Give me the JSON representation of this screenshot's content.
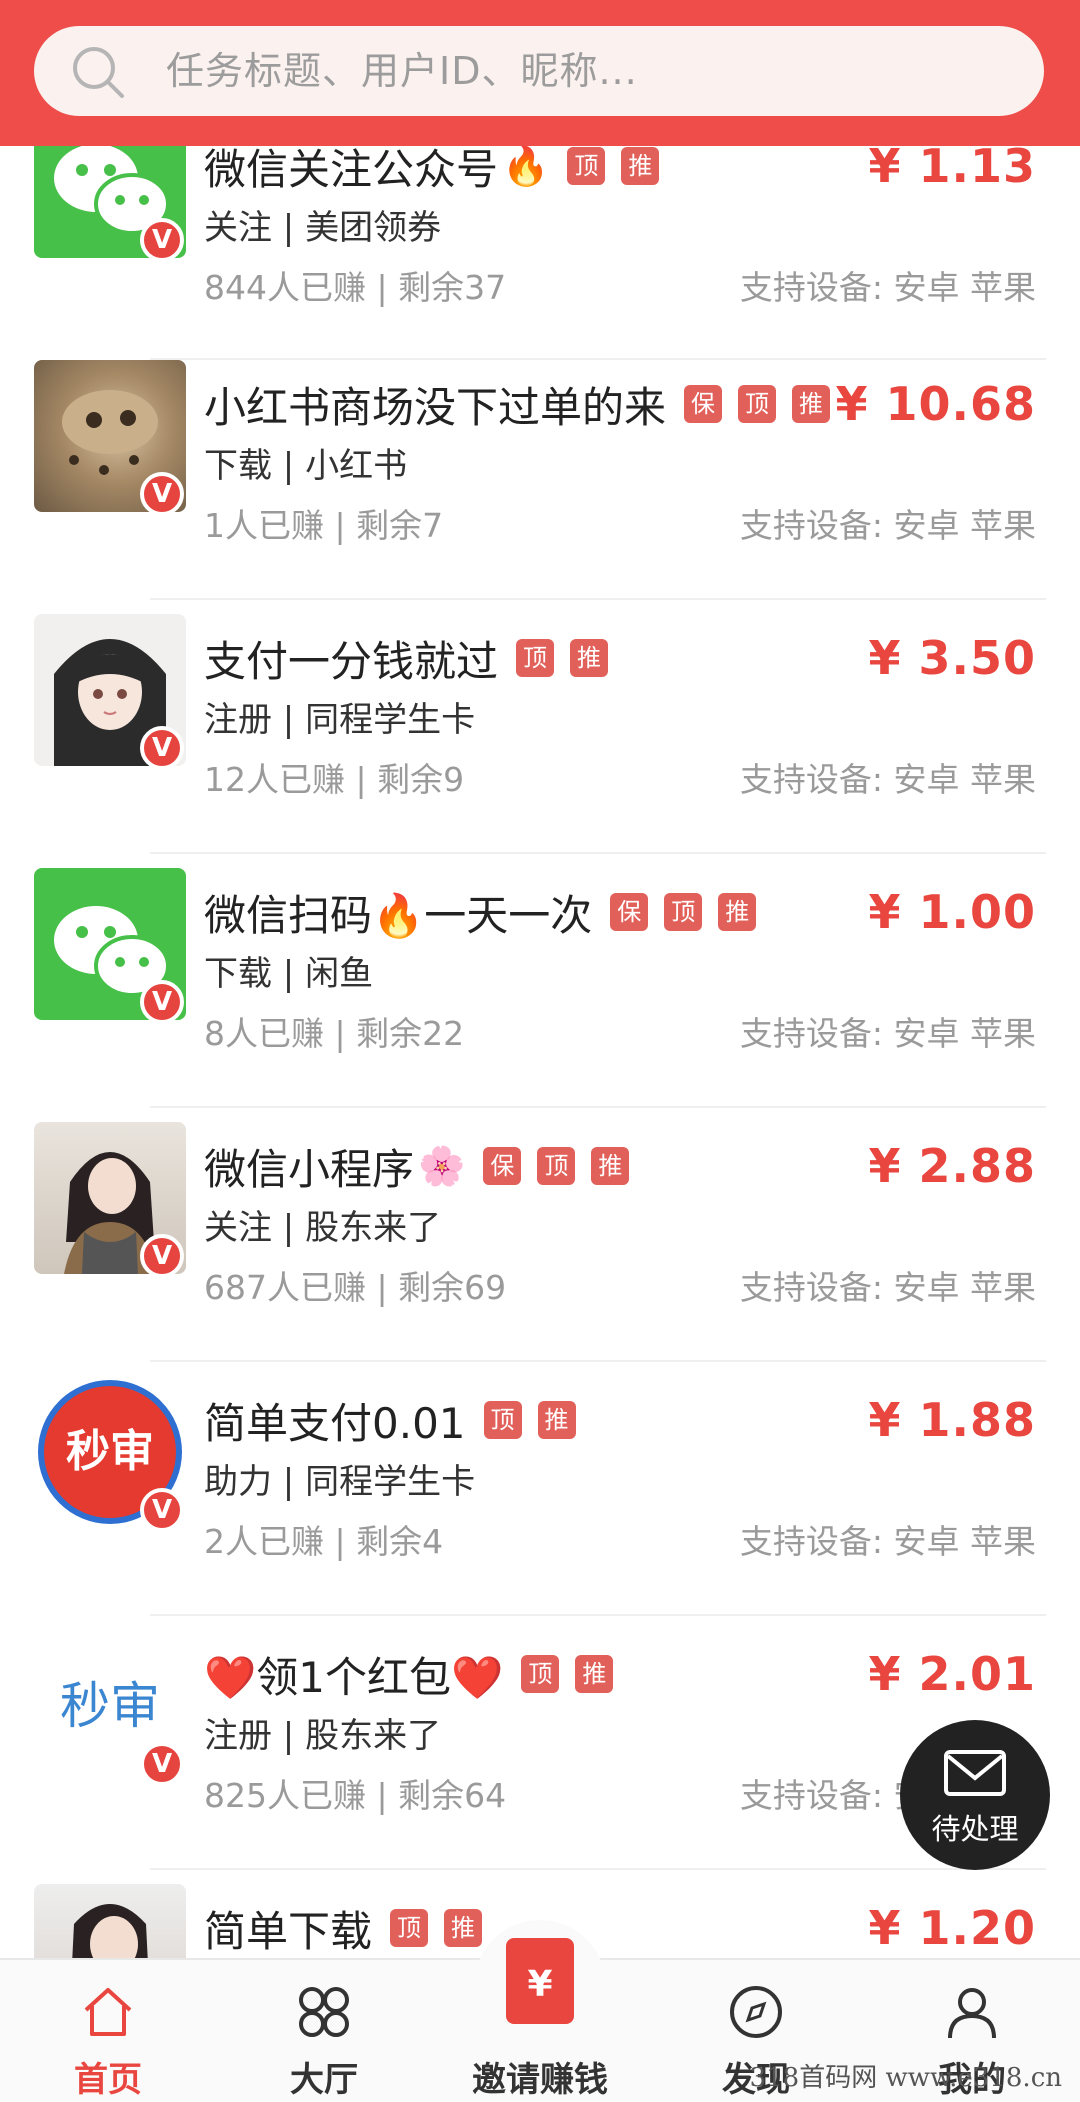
{
  "search": {
    "placeholder": "任务标题、用户ID、昵称..."
  },
  "tasks": [
    {
      "title": "微信关注公众号",
      "emoji": "🔥",
      "tags": [
        "顶",
        "推"
      ],
      "category": "关注 | 美团领券",
      "stats": "844人已赚 |  剩余37",
      "devices": "支持设备:  安卓 苹果",
      "price": "¥ 1.13",
      "avatar": "wechat"
    },
    {
      "title": "小红书商场没下过单的来",
      "emoji": "",
      "tags": [
        "保",
        "顶",
        "推"
      ],
      "category": "下载 | 小红书",
      "stats": "1人已赚 |  剩余7",
      "devices": "支持设备:  安卓 苹果",
      "price": "¥ 10.68",
      "avatar": "cat-photo"
    },
    {
      "title": "支付一分钱就过",
      "emoji": "",
      "tags": [
        "顶",
        "推"
      ],
      "category": "注册 | 同程学生卡",
      "stats": "12人已赚 |  剩余9",
      "devices": "支持设备:  安卓 苹果",
      "price": "¥ 3.50",
      "avatar": "anime-girl"
    },
    {
      "title": "微信扫码🔥一天一次",
      "emoji": "",
      "tags": [
        "保",
        "顶",
        "推"
      ],
      "category": "下载 | 闲鱼",
      "stats": "8人已赚 |  剩余22",
      "devices": "支持设备:  安卓 苹果",
      "price": "¥ 1.00",
      "avatar": "wechat"
    },
    {
      "title": "微信小程序",
      "emoji": "🌸",
      "tags": [
        "保",
        "顶",
        "推"
      ],
      "category": "关注 | 股东来了",
      "stats": "687人已赚 |  剩余69",
      "devices": "支持设备:  安卓 苹果",
      "price": "¥ 2.88",
      "avatar": "girl-photo"
    },
    {
      "title": "简单支付0.01",
      "emoji": "",
      "tags": [
        "顶",
        "推"
      ],
      "category": "助力 | 同程学生卡",
      "stats": "2人已赚 |  剩余4",
      "devices": "支持设备:  安卓 苹果",
      "price": "¥ 1.88",
      "avatar": "miaoshen-red"
    },
    {
      "title": "❤️领1个红包❤️",
      "emoji": "",
      "tags": [
        "顶",
        "推"
      ],
      "category": "注册 | 股东来了",
      "stats": "825人已赚 |  剩余64",
      "devices": "支持设备:  安卓 苹果",
      "price": "¥ 2.01",
      "avatar": "miaoshen-blue"
    },
    {
      "title": "简单下载",
      "emoji": "",
      "tags": [
        "顶",
        "推"
      ],
      "category": "",
      "stats": "",
      "devices": "",
      "price": "¥ 1.20",
      "avatar": "girl-photo-2"
    }
  ],
  "avatar_text": {
    "miaoshen": "秒审",
    "v": "V"
  },
  "float_button": {
    "label": "待处理",
    "icon": "mail-icon"
  },
  "nav": [
    {
      "label": "首页",
      "icon": "home-icon",
      "active": true
    },
    {
      "label": "大厅",
      "icon": "grid-icon",
      "active": false
    },
    {
      "label": "邀请赚钱",
      "icon": "red-envelope-icon",
      "active": false
    },
    {
      "label": "发现",
      "icon": "compass-icon",
      "active": false
    },
    {
      "label": "我的",
      "icon": "user-icon",
      "active": false
    }
  ],
  "invite_symbol": "¥",
  "watermark": "318首码网  www.e318.cn",
  "colors": {
    "brand": "#ee4d4a",
    "price": "#e8463f",
    "tag": "#e2605a",
    "wechat": "#46c048"
  }
}
